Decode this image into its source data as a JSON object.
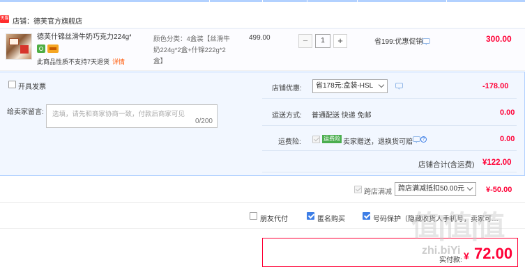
{
  "shop": {
    "badge": "天猫",
    "name": "店铺：德芙官方旗舰店"
  },
  "item": {
    "title": "德芙什锦丝滑牛奶巧克力224g*…",
    "spec_label": "颜色分类：4盒装【丝滑牛奶224g*2盒+什锦222g*2盒】",
    "return_note": "此商品性质不支持7天退货",
    "return_detail": "详情",
    "price": "499.00",
    "qty_minus": "−",
    "qty": "1",
    "qty_plus": "+",
    "promo": "省199:优惠促销",
    "total": "300.00"
  },
  "invoice": {
    "label": "开具发票"
  },
  "message": {
    "label": "给卖家留言:",
    "placeholder": "选填，请先和商家协商一致，付款后商家可见",
    "counter": "0/200"
  },
  "shop_discount": {
    "label": "店铺优惠:",
    "selected": "省178元:盒装-HSL",
    "amount": "-178.00"
  },
  "shipping": {
    "label": "运送方式:",
    "value": "普通配送 快递 免邮",
    "amount": "0.00"
  },
  "insurance": {
    "label": "运费险:",
    "badge": "运费险",
    "desc": "卖家赠送，退换货可赔",
    "amount": "0.00"
  },
  "shop_total": {
    "label": "店铺合计(含运费)",
    "value": "¥122.00"
  },
  "cross_store": {
    "label": "跨店满减",
    "selected": "跨店满减抵扣50.00元",
    "amount": "¥-50.00"
  },
  "options": {
    "friend_pay": "朋友代付",
    "anonymous": "匿名购买",
    "number_protect": "号码保护（隐藏收货人手机号，卖家可…"
  },
  "payment": {
    "label": "实付款:",
    "yen": "¥",
    "value": "72.00"
  },
  "watermark": {
    "mark": "值|值|值",
    "site": "zhi.biYi"
  },
  "colors": {
    "accent": "#ff0036",
    "blue_border": "#b2d1ff",
    "blue_bg": "#f2f7ff",
    "check_blue": "#3d7ee6"
  }
}
